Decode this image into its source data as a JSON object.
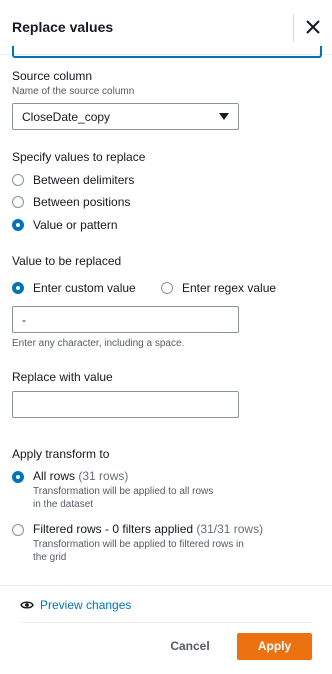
{
  "header": {
    "title": "Replace values"
  },
  "source_column": {
    "label": "Source column",
    "description": "Name of the source column",
    "selected": "CloseDate_copy"
  },
  "specify": {
    "label": "Specify values to replace",
    "options": [
      "Between delimiters",
      "Between positions",
      "Value or pattern"
    ],
    "selected_index": 2
  },
  "value_to_replace": {
    "label": "Value to be replaced",
    "options": [
      "Enter custom value",
      "Enter regex value"
    ],
    "selected_index": 0,
    "input_value": "-",
    "hint": "Enter any character, including a space."
  },
  "replace_with": {
    "label": "Replace with value",
    "input_value": ""
  },
  "apply_transform": {
    "label": "Apply transform to",
    "all_rows_label": "All rows",
    "all_rows_count": "(31 rows)",
    "all_rows_desc_1": "Transformation will be applied to all rows",
    "all_rows_desc_2": "in the dataset",
    "filtered_label": "Filtered rows - 0 filters applied",
    "filtered_count": "(31/31 rows)",
    "filtered_desc_1": "Transformation will be applied to filtered rows in",
    "filtered_desc_2": "the grid",
    "selected": "all_rows"
  },
  "preview_label": "Preview changes",
  "buttons": {
    "cancel": "Cancel",
    "apply": "Apply"
  },
  "icons": {
    "close": "close-icon",
    "preview": "eye-icon",
    "dropdown": "caret-down-icon"
  },
  "colors": {
    "accent": "#0073bb",
    "primary_button": "#ec7211"
  }
}
